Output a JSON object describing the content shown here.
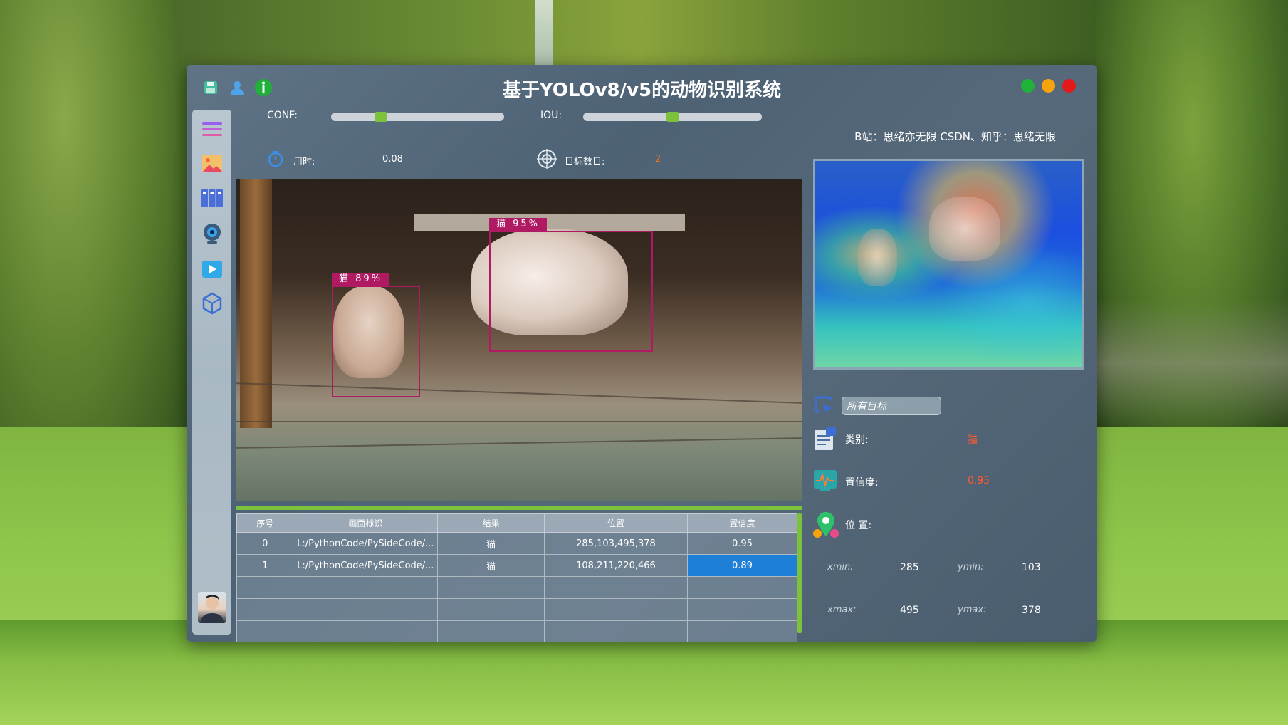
{
  "window": {
    "title": "基于YOLOv8/v5的动物识别系统",
    "credit": "B站：思绪亦无限  CSDN、知乎：思绪无限"
  },
  "toolbar": {
    "icons": [
      "save-icon",
      "user-icon",
      "info-icon"
    ]
  },
  "window_controls": {
    "colors": [
      "#1fb13a",
      "#f5a40d",
      "#e21a1a"
    ]
  },
  "sidebar": {
    "items": [
      "menu-icon",
      "image-icon",
      "batch-icon",
      "camera-icon",
      "video-icon",
      "model-icon"
    ]
  },
  "controls": {
    "conf_label": "CONF:",
    "iou_label": "IOU:",
    "conf_level": 0.27,
    "iou_level": 0.5,
    "time_label": "用时:",
    "time_value": "0.08",
    "count_label": "目标数目:",
    "count_value": "2"
  },
  "detections": [
    {
      "label": "猫  95%"
    },
    {
      "label": "猫  89%"
    }
  ],
  "table": {
    "headers": [
      "序号",
      "画面标识",
      "结果",
      "位置",
      "置信度"
    ],
    "rows": [
      [
        "0",
        "L:/PythonCode/PySideCode/...",
        "猫",
        "285,103,495,378",
        "0.95"
      ],
      [
        "1",
        "L:/PythonCode/PySideCode/...",
        "猫",
        "108,211,220,466",
        "0.89"
      ]
    ]
  },
  "info": {
    "target_select": "所有目标",
    "class_label": "类别:",
    "class_value": "猫",
    "conf_label": "置信度:",
    "conf_value": "0.95",
    "pos_label": "位 置:",
    "xmin_label": "xmin:",
    "xmin_value": "285",
    "ymin_label": "ymin:",
    "ymin_value": "103",
    "xmax_label": "xmax:",
    "xmax_value": "495",
    "ymax_label": "ymax:",
    "ymax_value": "378"
  }
}
